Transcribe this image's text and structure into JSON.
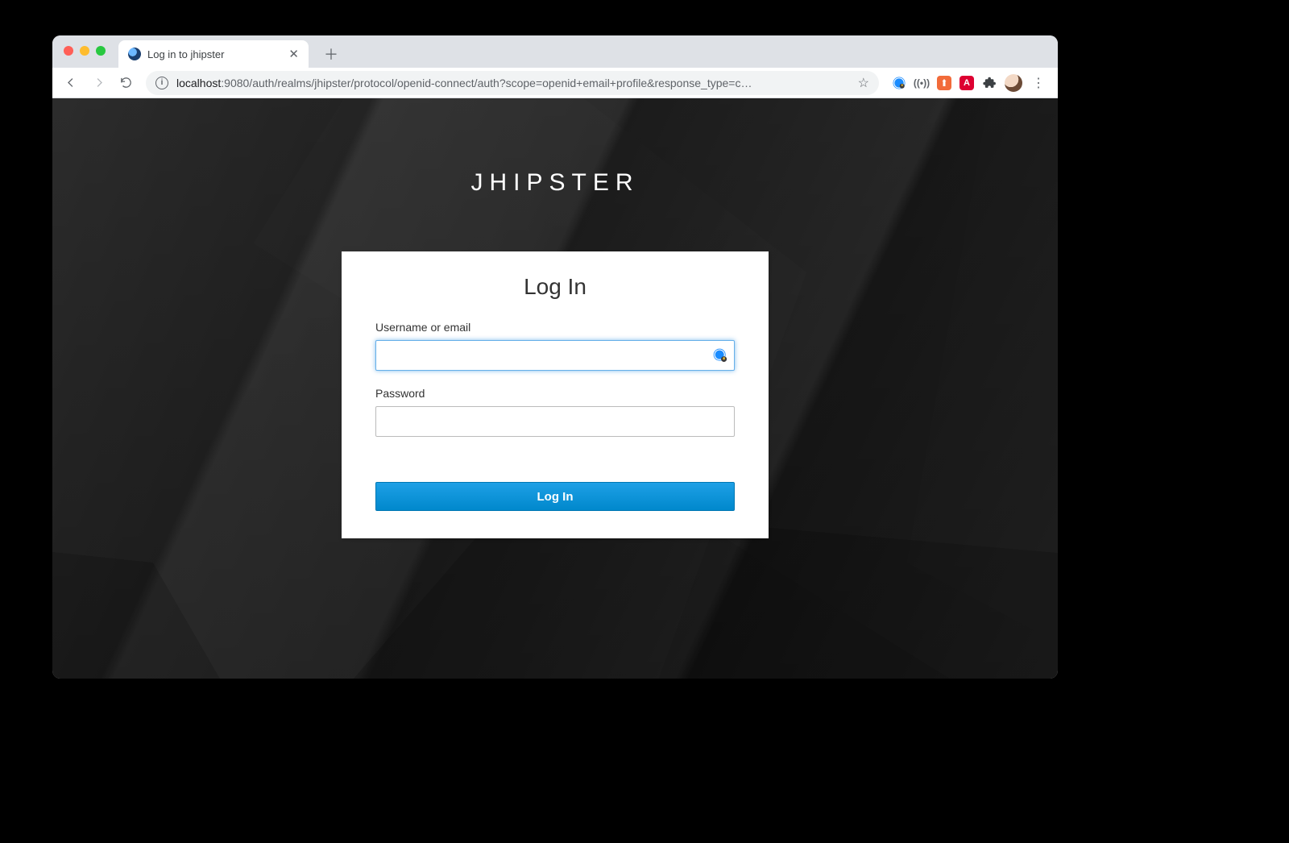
{
  "browser": {
    "tab": {
      "title": "Log in to jhipster"
    },
    "omnibox": {
      "host": "localhost",
      "rest": ":9080/auth/realms/jhipster/protocol/openid-connect/auth?scope=openid+email+profile&response_type=c…"
    },
    "icons": {
      "back": "back-icon",
      "forward": "forward-icon",
      "reload": "reload-icon",
      "info": "site-info-icon",
      "star": "star-icon",
      "onepassword": "onepassword-icon",
      "browsersync": "browsersync-icon",
      "lighthouse": "lighthouse-icon",
      "angular": "angular-icon",
      "extensions": "extensions-icon",
      "avatar": "profile-avatar",
      "menu": "browser-menu-icon",
      "newtab": "new-tab-icon",
      "closetab": "close-tab-icon"
    }
  },
  "page": {
    "realm": "JHIPSTER",
    "card": {
      "heading": "Log In",
      "username_label": "Username or email",
      "username_value": "",
      "password_label": "Password",
      "password_value": "",
      "submit_label": "Log In"
    }
  },
  "colors": {
    "accent": "#0088cc",
    "focus_ring": "#66afe9",
    "tabstrip_bg": "#dee1e6"
  }
}
